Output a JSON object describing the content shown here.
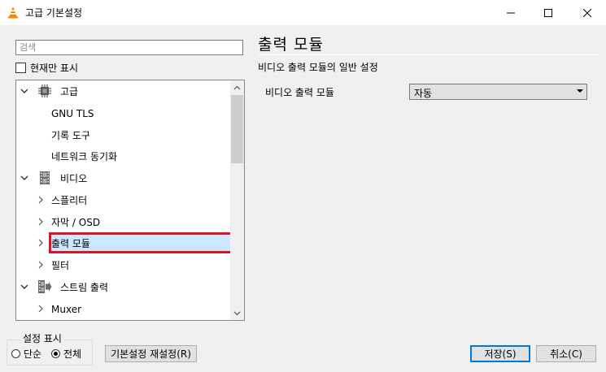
{
  "window": {
    "title": "고급 기본설정",
    "controls": {
      "minimize": "minimize-icon",
      "maximize": "maximize-icon",
      "close": "close-icon"
    }
  },
  "search": {
    "placeholder": "검색"
  },
  "current_only": {
    "label": "현재만 표시",
    "checked": false
  },
  "tree": {
    "items": [
      {
        "label": "고급",
        "icon": "cpu-chip-icon",
        "expanded": true,
        "level": 0
      },
      {
        "label": "GNU TLS",
        "level": 1
      },
      {
        "label": "기록 도구",
        "level": 1
      },
      {
        "label": "네트워크 동기화",
        "level": 1
      },
      {
        "label": "비디오",
        "icon": "film-strip-icon",
        "expanded": true,
        "level": 0
      },
      {
        "label": "스플리터",
        "level": 1,
        "collapsed": true
      },
      {
        "label": "자막 / OSD",
        "level": 1,
        "collapsed": true
      },
      {
        "label": "출력 모듈",
        "level": 1,
        "collapsed": true,
        "selected": true
      },
      {
        "label": "필터",
        "level": 1,
        "collapsed": true
      },
      {
        "label": "스트림 출력",
        "icon": "stream-output-icon",
        "expanded": true,
        "level": 0
      },
      {
        "label": "Muxer",
        "level": 1,
        "collapsed": true
      }
    ]
  },
  "panel": {
    "title": "출력 모듈",
    "subtitle": "비디오 출력 모듈의 일반 설정",
    "option_label": "비디오 출력 모듈",
    "option_value": "자동"
  },
  "show_settings": {
    "title": "설정 표시",
    "simple_label": "단순",
    "all_label": "전체",
    "selected": "all"
  },
  "buttons": {
    "reset": "기본설정 재설정(R)",
    "save": "저장(S)",
    "cancel": "취소(C)"
  },
  "colors": {
    "selection": "#cce8ff",
    "highlight_border": "#e0121f",
    "primary_border": "#0078d7"
  }
}
